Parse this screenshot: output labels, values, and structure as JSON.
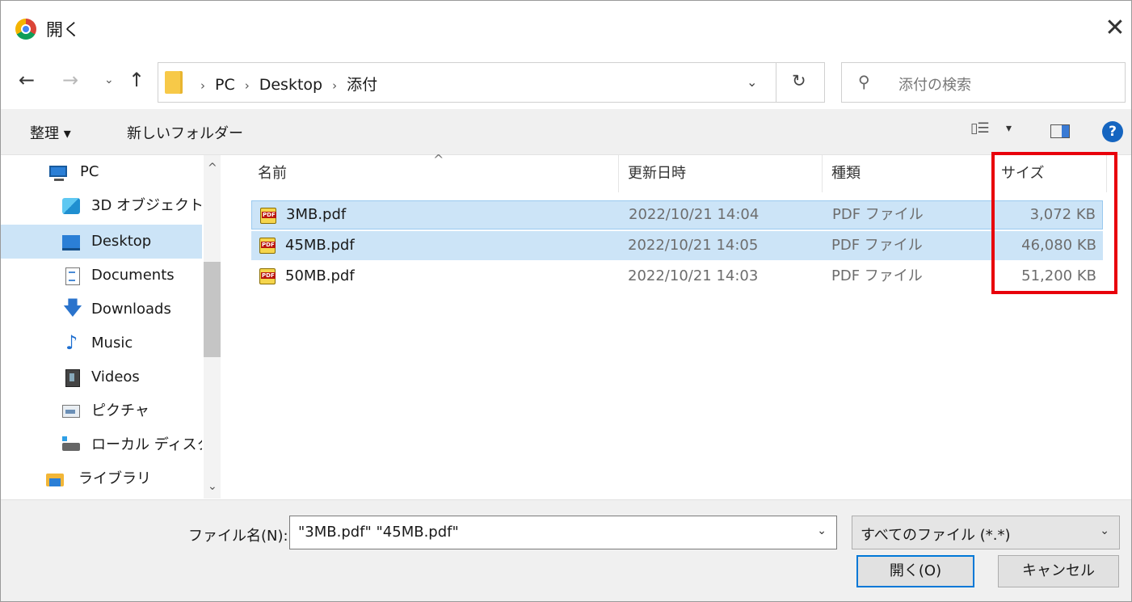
{
  "window": {
    "title": "開く",
    "close_glyph": "✕"
  },
  "nav": {
    "back_glyph": "←",
    "forward_glyph": "→",
    "recent_glyph": "⌄",
    "up_glyph": "↑",
    "breadcrumb": [
      "PC",
      "Desktop",
      "添付"
    ],
    "dropdown_glyph": "⌄",
    "refresh_glyph": "↻",
    "search_placeholder": "添付の検索"
  },
  "toolbar": {
    "organize_label": "整理 ▾",
    "new_folder_label": "新しいフォルダー",
    "view_arrow": "▾",
    "help_glyph": "?"
  },
  "sidebar": {
    "items": [
      {
        "label": "PC",
        "icon": "pc-icon"
      },
      {
        "label": "3D オブジェクト",
        "icon": "3d-objects-icon"
      },
      {
        "label": "Desktop",
        "icon": "desktop-icon",
        "active": true
      },
      {
        "label": "Documents",
        "icon": "documents-icon"
      },
      {
        "label": "Downloads",
        "icon": "downloads-icon"
      },
      {
        "label": "Music",
        "icon": "music-icon"
      },
      {
        "label": "Videos",
        "icon": "videos-icon"
      },
      {
        "label": "ピクチャ",
        "icon": "pictures-icon"
      },
      {
        "label": "ローカル ディスク (",
        "icon": "local-disk-icon"
      },
      {
        "label": "ライブラリ",
        "icon": "library-icon"
      }
    ],
    "scroll_up_glyph": "^",
    "scroll_down_glyph": "⌄"
  },
  "filelist": {
    "columns": {
      "name": "名前",
      "date": "更新日時",
      "type": "種類",
      "size": "サイズ"
    },
    "sort_glyph": "^",
    "rows": [
      {
        "name": "3MB.pdf",
        "date": "2022/10/21 14:04",
        "type": "PDF ファイル",
        "size": "3,072 KB",
        "selected": true
      },
      {
        "name": "45MB.pdf",
        "date": "2022/10/21 14:05",
        "type": "PDF ファイル",
        "size": "46,080 KB",
        "selected": true
      },
      {
        "name": "50MB.pdf",
        "date": "2022/10/21 14:03",
        "type": "PDF ファイル",
        "size": "51,200 KB",
        "selected": false
      }
    ]
  },
  "bottom": {
    "filename_label": "ファイル名(N):",
    "filename_value": "\"3MB.pdf\" \"45MB.pdf\"",
    "filename_arrow": "⌄",
    "filter_value": "すべてのファイル (*.*)",
    "filter_arrow": "⌄",
    "open_button": "開く(O)",
    "cancel_button": "キャンセル"
  },
  "colors": {
    "selection": "#cce4f7",
    "highlight_box": "#e8000b",
    "accent": "#0078d7"
  }
}
